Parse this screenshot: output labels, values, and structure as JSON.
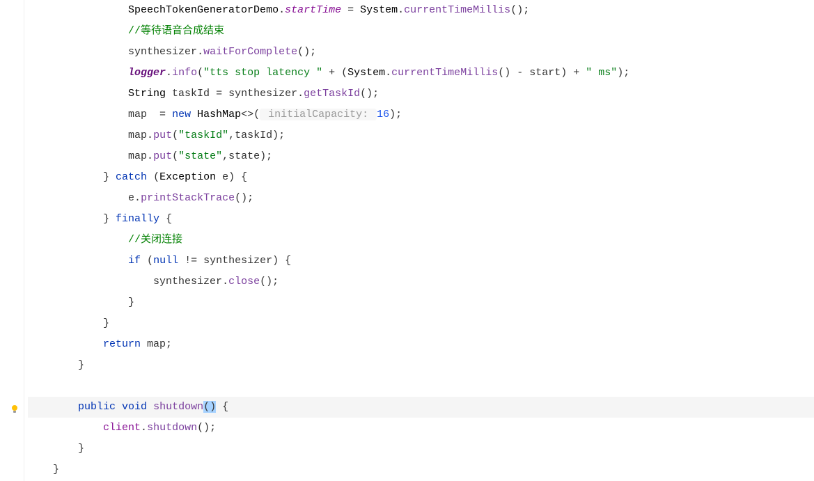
{
  "code": {
    "lines": [
      {
        "indent": 16,
        "tokens": [
          {
            "t": "SpeechTokenGeneratorDemo",
            "cls": "type"
          },
          {
            "t": ".",
            "cls": "punct"
          },
          {
            "t": "startTime",
            "cls": "static-field"
          },
          {
            "t": " = ",
            "cls": "punct"
          },
          {
            "t": "System",
            "cls": "type"
          },
          {
            "t": ".",
            "cls": "punct"
          },
          {
            "t": "currentTimeMillis",
            "cls": "method"
          },
          {
            "t": "();",
            "cls": "punct"
          }
        ]
      },
      {
        "indent": 16,
        "tokens": [
          {
            "t": "//等待语音合成结束",
            "cls": "comment"
          }
        ]
      },
      {
        "indent": 16,
        "tokens": [
          {
            "t": "synthesizer",
            "cls": "ident"
          },
          {
            "t": ".",
            "cls": "punct"
          },
          {
            "t": "waitForComplete",
            "cls": "method"
          },
          {
            "t": "();",
            "cls": "punct"
          }
        ]
      },
      {
        "indent": 16,
        "tokens": [
          {
            "t": "logger",
            "cls": "logger"
          },
          {
            "t": ".",
            "cls": "punct"
          },
          {
            "t": "info",
            "cls": "method"
          },
          {
            "t": "(",
            "cls": "punct"
          },
          {
            "t": "\"tts stop latency \"",
            "cls": "string"
          },
          {
            "t": " + (",
            "cls": "punct"
          },
          {
            "t": "System",
            "cls": "type"
          },
          {
            "t": ".",
            "cls": "punct"
          },
          {
            "t": "currentTimeMillis",
            "cls": "method"
          },
          {
            "t": "() - ",
            "cls": "punct"
          },
          {
            "t": "start",
            "cls": "ident"
          },
          {
            "t": ") + ",
            "cls": "punct"
          },
          {
            "t": "\" ms\"",
            "cls": "string"
          },
          {
            "t": ");",
            "cls": "punct"
          }
        ]
      },
      {
        "indent": 16,
        "tokens": [
          {
            "t": "String ",
            "cls": "type"
          },
          {
            "t": "taskId",
            "cls": "ident"
          },
          {
            "t": " = ",
            "cls": "punct"
          },
          {
            "t": "synthesizer",
            "cls": "ident"
          },
          {
            "t": ".",
            "cls": "punct"
          },
          {
            "t": "getTaskId",
            "cls": "method"
          },
          {
            "t": "();",
            "cls": "punct"
          }
        ]
      },
      {
        "indent": 16,
        "tokens": [
          {
            "t": "map",
            "cls": "ident"
          },
          {
            "t": "  = ",
            "cls": "punct"
          },
          {
            "t": "new ",
            "cls": "keyword"
          },
          {
            "t": "HashMap",
            "cls": "type"
          },
          {
            "t": "<>(",
            "cls": "punct"
          },
          {
            "t": " initialCapacity: ",
            "cls": "param-hint"
          },
          {
            "t": "16",
            "cls": "number"
          },
          {
            "t": ");",
            "cls": "punct"
          }
        ]
      },
      {
        "indent": 16,
        "tokens": [
          {
            "t": "map",
            "cls": "ident"
          },
          {
            "t": ".",
            "cls": "punct"
          },
          {
            "t": "put",
            "cls": "method"
          },
          {
            "t": "(",
            "cls": "punct"
          },
          {
            "t": "\"taskId\"",
            "cls": "string"
          },
          {
            "t": ",",
            "cls": "punct"
          },
          {
            "t": "taskId",
            "cls": "ident"
          },
          {
            "t": ");",
            "cls": "punct"
          }
        ]
      },
      {
        "indent": 16,
        "tokens": [
          {
            "t": "map",
            "cls": "ident"
          },
          {
            "t": ".",
            "cls": "punct"
          },
          {
            "t": "put",
            "cls": "method"
          },
          {
            "t": "(",
            "cls": "punct"
          },
          {
            "t": "\"state\"",
            "cls": "string"
          },
          {
            "t": ",",
            "cls": "punct"
          },
          {
            "t": "state",
            "cls": "ident"
          },
          {
            "t": ");",
            "cls": "punct"
          }
        ]
      },
      {
        "indent": 12,
        "tokens": [
          {
            "t": "} ",
            "cls": "punct"
          },
          {
            "t": "catch",
            "cls": "keyword"
          },
          {
            "t": " (",
            "cls": "punct"
          },
          {
            "t": "Exception ",
            "cls": "type"
          },
          {
            "t": "e",
            "cls": "ident"
          },
          {
            "t": ") {",
            "cls": "punct"
          }
        ]
      },
      {
        "indent": 16,
        "tokens": [
          {
            "t": "e",
            "cls": "ident"
          },
          {
            "t": ".",
            "cls": "punct"
          },
          {
            "t": "printStackTrace",
            "cls": "method"
          },
          {
            "t": "();",
            "cls": "punct"
          }
        ]
      },
      {
        "indent": 12,
        "tokens": [
          {
            "t": "} ",
            "cls": "punct"
          },
          {
            "t": "finally",
            "cls": "keyword"
          },
          {
            "t": " {",
            "cls": "punct"
          }
        ]
      },
      {
        "indent": 16,
        "tokens": [
          {
            "t": "//关闭连接",
            "cls": "comment"
          }
        ]
      },
      {
        "indent": 16,
        "tokens": [
          {
            "t": "if",
            "cls": "keyword"
          },
          {
            "t": " (",
            "cls": "punct"
          },
          {
            "t": "null",
            "cls": "keyword"
          },
          {
            "t": " != ",
            "cls": "punct"
          },
          {
            "t": "synthesizer",
            "cls": "ident"
          },
          {
            "t": ") {",
            "cls": "punct"
          }
        ]
      },
      {
        "indent": 20,
        "tokens": [
          {
            "t": "synthesizer",
            "cls": "ident"
          },
          {
            "t": ".",
            "cls": "punct"
          },
          {
            "t": "close",
            "cls": "method"
          },
          {
            "t": "();",
            "cls": "punct"
          }
        ]
      },
      {
        "indent": 16,
        "tokens": [
          {
            "t": "}",
            "cls": "punct"
          }
        ]
      },
      {
        "indent": 12,
        "tokens": [
          {
            "t": "}",
            "cls": "punct"
          }
        ]
      },
      {
        "indent": 12,
        "tokens": [
          {
            "t": "return",
            "cls": "keyword"
          },
          {
            "t": " map;",
            "cls": "punct"
          }
        ]
      },
      {
        "indent": 8,
        "tokens": [
          {
            "t": "}",
            "cls": "punct"
          }
        ]
      },
      {
        "indent": 0,
        "tokens": []
      },
      {
        "indent": 8,
        "highlighted": true,
        "tokens": [
          {
            "t": "public",
            "cls": "keyword"
          },
          {
            "t": " ",
            "cls": "punct"
          },
          {
            "t": "void",
            "cls": "keyword"
          },
          {
            "t": " ",
            "cls": "punct"
          },
          {
            "t": "shutdown",
            "cls": "method"
          },
          {
            "t": "()",
            "cls": "punct",
            "selected": true
          },
          {
            "t": " {",
            "cls": "punct"
          }
        ]
      },
      {
        "indent": 12,
        "tokens": [
          {
            "t": "client",
            "cls": "field"
          },
          {
            "t": ".",
            "cls": "punct"
          },
          {
            "t": "shutdown",
            "cls": "method"
          },
          {
            "t": "();",
            "cls": "punct"
          }
        ]
      },
      {
        "indent": 8,
        "tokens": [
          {
            "t": "}",
            "cls": "punct"
          }
        ]
      },
      {
        "indent": 4,
        "tokens": [
          {
            "t": "}",
            "cls": "punct"
          }
        ]
      }
    ]
  },
  "gutter": {
    "bulb_line_index": 19
  }
}
